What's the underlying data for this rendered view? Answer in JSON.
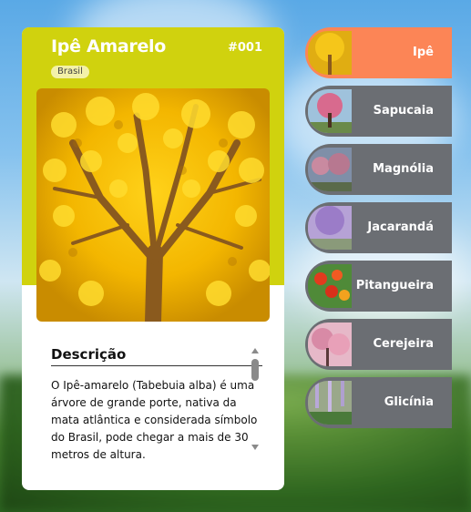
{
  "card": {
    "title": "Ipê Amarelo",
    "number": "#001",
    "tag": "Brasil",
    "description_title": "Descrição",
    "description_text": "O Ipê-amarelo (Tabebuia alba) é uma árvore de grande porte, nativa da mata atlântica e considerada símbolo do Brasil, pode chegar a mais de 30 metros de altura."
  },
  "colors": {
    "card_header": "#d0d20e",
    "nav_active": "#fc8556",
    "nav_inactive": "#6b6e73"
  },
  "nav": {
    "items": [
      {
        "label": "Ipê",
        "active": true
      },
      {
        "label": "Sapucaia",
        "active": false
      },
      {
        "label": "Magnólia",
        "active": false
      },
      {
        "label": "Jacarandá",
        "active": false
      },
      {
        "label": "Pitangueira",
        "active": false
      },
      {
        "label": "Cerejeira",
        "active": false
      },
      {
        "label": "Glicínia",
        "active": false
      }
    ]
  }
}
